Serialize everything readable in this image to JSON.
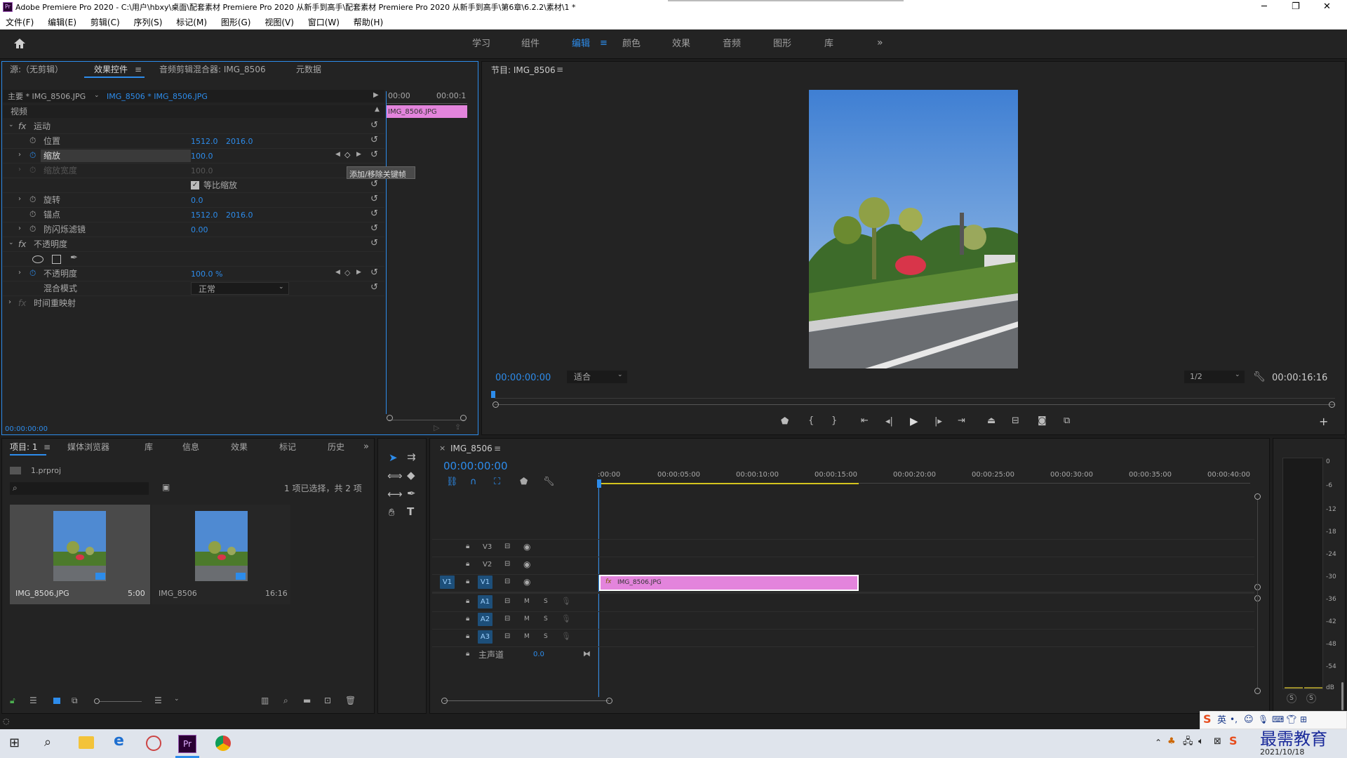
{
  "window": {
    "title": "Adobe Premiere Pro 2020 - C:\\用户\\hbxy\\桌面\\配套素材 Premiere Pro 2020 从新手到高手\\配套素材 Premiere Pro 2020 从新手到高手\\第6章\\6.2.2\\素材\\1 *",
    "min": "─",
    "max": "❐",
    "close": "✕"
  },
  "menu": [
    "文件(F)",
    "编辑(E)",
    "剪辑(C)",
    "序列(S)",
    "标记(M)",
    "图形(G)",
    "视图(V)",
    "窗口(W)",
    "帮助(H)"
  ],
  "workspaces": [
    "学习",
    "组件",
    "编辑",
    "颜色",
    "效果",
    "音频",
    "图形",
    "库"
  ],
  "workspace_active": "编辑",
  "effect_panel": {
    "tabs": [
      "源:（无剪辑）",
      "效果控件",
      "音频剪辑混合器: IMG_8506",
      "元数据"
    ],
    "master": "主要 * IMG_8506.JPG",
    "seq_clip": "IMG_8506 * IMG_8506.JPG",
    "time_start": "00:00",
    "time_end": "00:00:1",
    "clip_label": "IMG_8506.JPG",
    "video": "视频",
    "motion": "运动",
    "position": {
      "label": "位置",
      "x": "1512.0",
      "y": "2016.0"
    },
    "scale": {
      "label": "缩放",
      "value": "100.0"
    },
    "scale_width": {
      "label": "缩放宽度",
      "value": "100.0"
    },
    "uniform": "等比缩放",
    "rotation": {
      "label": "旋转",
      "value": "0.0"
    },
    "anchor": {
      "label": "锚点",
      "x": "1512.0",
      "y": "2016.0"
    },
    "flicker": {
      "label": "防闪烁滤镜",
      "value": "0.00"
    },
    "opacity_group": "不透明度",
    "opacity": {
      "label": "不透明度",
      "value": "100.0 %"
    },
    "blend": {
      "label": "混合模式",
      "value": "正常"
    },
    "timeremap": "时间重映射",
    "tooltip": "添加/移除关键帧",
    "fx": "fx",
    "timecode": "00:00:00:00"
  },
  "program": {
    "title": "节目: IMG_8506",
    "timecode": "00:00:00:00",
    "fit": "适合",
    "quality": "1/2",
    "duration": "00:00:16:16"
  },
  "project": {
    "tabs": [
      "项目: 1",
      "媒体浏览器",
      "库",
      "信息",
      "效果",
      "标记",
      "历史"
    ],
    "file": "1.prproj",
    "status": "1 项已选择，共 2 项",
    "items": [
      {
        "name": "IMG_8506.JPG",
        "dur": "5:00"
      },
      {
        "name": "IMG_8506",
        "dur": "16:16"
      }
    ]
  },
  "timeline": {
    "tab": "IMG_8506",
    "timecode": "00:00:00:00",
    "ruler": [
      ":00:00",
      "00:00:05:00",
      "00:00:10:00",
      "00:00:15:00",
      "00:00:20:00",
      "00:00:25:00",
      "00:00:30:00",
      "00:00:35:00",
      "00:00:40:00"
    ],
    "video_tracks": [
      "V3",
      "V2",
      "V1"
    ],
    "audio_tracks": [
      "A1",
      "A2",
      "A3"
    ],
    "src_patch": "V1",
    "m": "M",
    "s": "S",
    "master": "主声道",
    "master_val": "0.0",
    "clip": "IMG_8506.JPG"
  },
  "meter": {
    "ticks": [
      "0",
      "-6",
      "-12",
      "-18",
      "-24",
      "-30",
      "-36",
      "-42",
      "-48",
      "-54",
      "dB"
    ],
    "s": "S"
  },
  "tray": {
    "ime": "英",
    "date": "2021/10/18",
    "watermark": "最需教育"
  },
  "colors": {
    "accent": "#2d8ceb",
    "clip": "#e384dc"
  }
}
